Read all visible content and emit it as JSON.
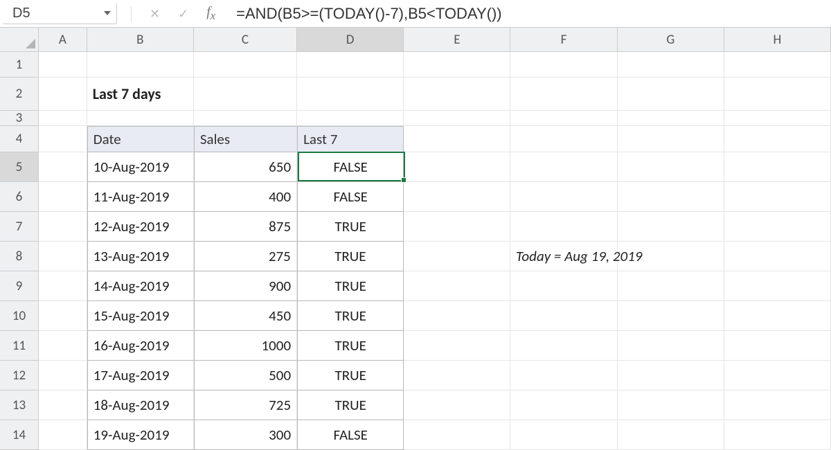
{
  "chart_data": {
    "type": "table",
    "title": "Last 7 days",
    "columns": [
      "Date",
      "Sales",
      "Last 7"
    ],
    "rows": [
      [
        "10-Aug-2019",
        650,
        "FALSE"
      ],
      [
        "11-Aug-2019",
        400,
        "FALSE"
      ],
      [
        "12-Aug-2019",
        875,
        "TRUE"
      ],
      [
        "13-Aug-2019",
        275,
        "TRUE"
      ],
      [
        "14-Aug-2019",
        900,
        "TRUE"
      ],
      [
        "15-Aug-2019",
        450,
        "TRUE"
      ],
      [
        "16-Aug-2019",
        1000,
        "TRUE"
      ],
      [
        "17-Aug-2019",
        500,
        "TRUE"
      ],
      [
        "18-Aug-2019",
        725,
        "TRUE"
      ],
      [
        "19-Aug-2019",
        300,
        "FALSE"
      ]
    ],
    "annotation": "Today = Aug 19, 2019"
  },
  "namebox": {
    "value": "D5"
  },
  "formula": {
    "value": "=AND(B5>=(TODAY()-7),B5<TODAY())"
  },
  "columns": {
    "labels": [
      "A",
      "B",
      "C",
      "D",
      "E",
      "F",
      "G",
      "H"
    ],
    "widths": [
      70,
      155,
      150,
      155,
      155,
      155,
      155,
      155
    ],
    "active_index": 3
  },
  "rows": {
    "heights": [
      37,
      48,
      22,
      38,
      43,
      43,
      43,
      43,
      43,
      43,
      43,
      43,
      43,
      43
    ],
    "active_index": 4
  },
  "sheet": {
    "title": "Last 7 days",
    "headers": {
      "date": "Date",
      "sales": "Sales",
      "last7": "Last 7"
    },
    "data": [
      {
        "date": "10-Aug-2019",
        "sales": "650",
        "last7": "FALSE"
      },
      {
        "date": "11-Aug-2019",
        "sales": "400",
        "last7": "FALSE"
      },
      {
        "date": "12-Aug-2019",
        "sales": "875",
        "last7": "TRUE"
      },
      {
        "date": "13-Aug-2019",
        "sales": "275",
        "last7": "TRUE"
      },
      {
        "date": "14-Aug-2019",
        "sales": "900",
        "last7": "TRUE"
      },
      {
        "date": "15-Aug-2019",
        "sales": "450",
        "last7": "TRUE"
      },
      {
        "date": "16-Aug-2019",
        "sales": "1000",
        "last7": "TRUE"
      },
      {
        "date": "17-Aug-2019",
        "sales": "500",
        "last7": "TRUE"
      },
      {
        "date": "18-Aug-2019",
        "sales": "725",
        "last7": "TRUE"
      },
      {
        "date": "19-Aug-2019",
        "sales": "300",
        "last7": "FALSE"
      }
    ],
    "note": "Today = Aug 19, 2019"
  },
  "active_cell": {
    "ref": "D5",
    "col": 3,
    "row": 4
  }
}
